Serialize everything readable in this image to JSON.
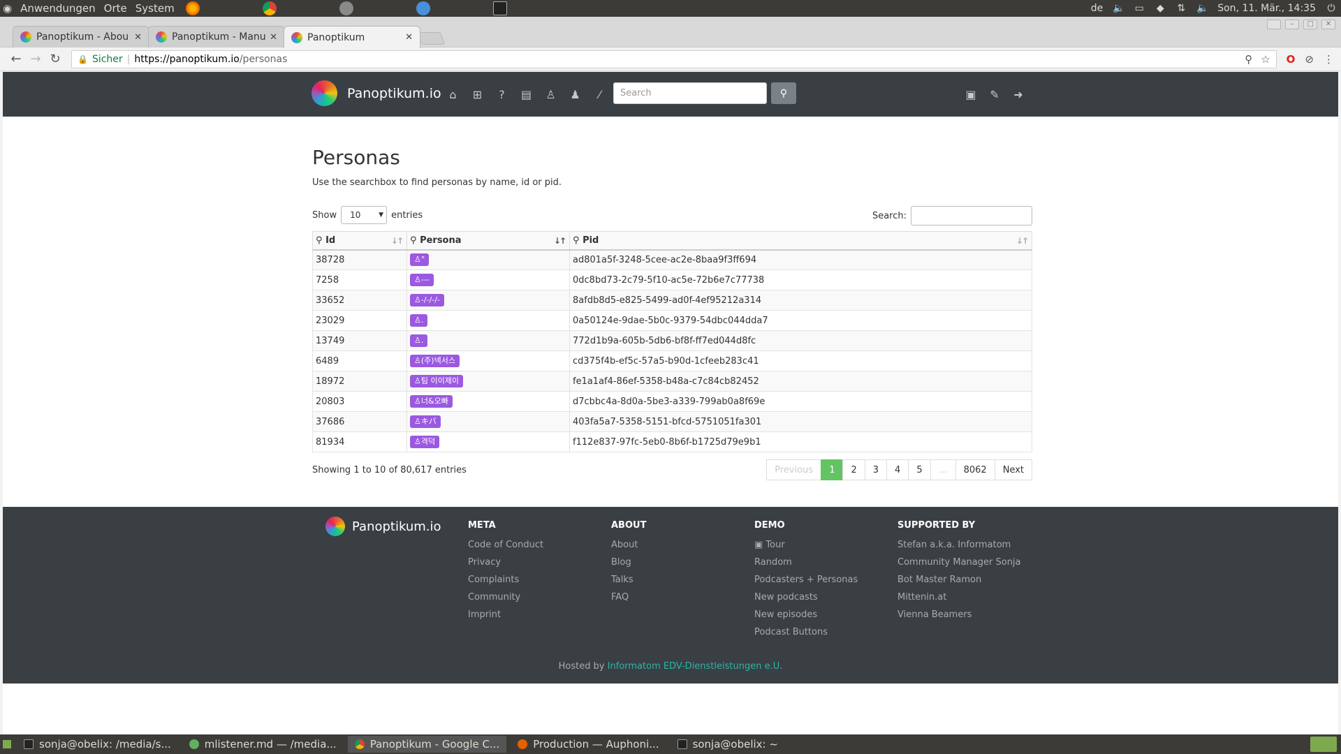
{
  "panel": {
    "menu": [
      "Anwendungen",
      "Orte",
      "System"
    ],
    "keyboard_layout": "de",
    "datetime": "Son, 11. Mär., 14:35"
  },
  "browser": {
    "tabs": [
      {
        "title": "Panoptikum - Abou"
      },
      {
        "title": "Panoptikum - Manu"
      },
      {
        "title": "Panoptikum"
      }
    ],
    "address": {
      "secure_label": "Sicher",
      "scheme_host": "https://panoptikum.io",
      "path": "/personas"
    }
  },
  "site": {
    "brand": "Panoptikum.io",
    "search_placeholder": "Search",
    "nav_icons": [
      "home-icon",
      "sitemap-icon",
      "question-icon",
      "newspaper-icon",
      "user-outline-icon",
      "user-icon",
      "magic-icon"
    ],
    "right_icons": [
      "bus-icon",
      "pencil-icon",
      "sign-in-icon"
    ]
  },
  "page": {
    "title": "Personas",
    "description": "Use the searchbox to find personas by name, id or pid.",
    "length_label_before": "Show",
    "length_value": "10",
    "length_label_after": "entries",
    "search_label": "Search:",
    "columns": [
      "Id",
      "Persona",
      "Pid"
    ],
    "rows": [
      {
        "id": "38728",
        "persona": "°",
        "pid": "ad801a5f-3248-5cee-ac2e-8baa9f3ff694"
      },
      {
        "id": "7258",
        "persona": "---",
        "pid": "0dc8bd73-2c79-5f10-ac5e-72b6e7c77738"
      },
      {
        "id": "33652",
        "persona": "-/-/-/-",
        "pid": "8afdb8d5-e825-5499-ad0f-4ef95212a314"
      },
      {
        "id": "23029",
        "persona": ".",
        "pid": "0a50124e-9dae-5b0c-9379-54dbc044dda7"
      },
      {
        "id": "13749",
        "persona": ".",
        "pid": "772d1b9a-605b-5db6-bf8f-ff7ed044d8fc"
      },
      {
        "id": "6489",
        "persona": "(주)넥서스",
        "pid": "cd375f4b-ef5c-57a5-b90d-1cfeeb283c41"
      },
      {
        "id": "18972",
        "persona": "팀 이이제이",
        "pid": "fe1a1af4-86ef-5358-b48a-c7c84cb82452"
      },
      {
        "id": "20803",
        "persona": "너&오빠",
        "pid": "d7cbbc4a-8d0a-5be3-a339-799ab0a8f69e"
      },
      {
        "id": "37686",
        "persona": "キバ",
        "pid": "403fa5a7-5358-5151-bfcd-5751051fa301"
      },
      {
        "id": "81934",
        "persona": "격덕",
        "pid": "f112e837-97fc-5eb0-8b6f-b1725d79e9b1"
      }
    ],
    "info": "Showing 1 to 10 of 80,617 entries",
    "pagination": [
      "Previous",
      "1",
      "2",
      "3",
      "4",
      "5",
      "…",
      "8062",
      "Next"
    ]
  },
  "footer": {
    "brand": "Panoptikum.io",
    "columns": [
      {
        "heading": "META",
        "links": [
          "Code of Conduct",
          "Privacy",
          "Complaints",
          "Community",
          "Imprint"
        ]
      },
      {
        "heading": "ABOUT",
        "links": [
          "About",
          "Blog",
          "Talks",
          "FAQ"
        ]
      },
      {
        "heading": "DEMO",
        "links": [
          "Tour",
          "Random",
          "Podcasters + Personas",
          "New podcasts",
          "New episodes",
          "Podcast Buttons"
        ]
      },
      {
        "heading": "SUPPORTED BY",
        "links": [
          "Stefan a.k.a. Informatom",
          "Community Manager Sonja",
          "Bot Master Ramon",
          "Mittenin.at",
          "Vienna Beamers"
        ]
      }
    ],
    "hosted_prefix": "Hosted by",
    "hosted_link": "Informatom EDV-Dienstleistungen e.U."
  },
  "taskbar": {
    "items": [
      {
        "label": "sonja@obelix: /media/s..."
      },
      {
        "label": "mlistener.md — /media..."
      },
      {
        "label": "Panoptikum - Google C..."
      },
      {
        "label": "Production — Auphoni..."
      },
      {
        "label": "sonja@obelix: ~"
      }
    ]
  },
  "colors": {
    "navbar": "#3a3f44",
    "badge": "#9b59e0",
    "page_active": "#62c462",
    "footer_link": "#2ab6a4"
  }
}
